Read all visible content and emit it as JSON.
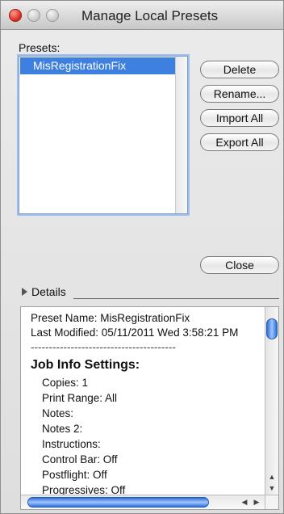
{
  "window": {
    "title": "Manage Local Presets"
  },
  "presets": {
    "label": "Presets:",
    "items": [
      "MisRegistrationFix"
    ]
  },
  "buttons": {
    "delete": "Delete",
    "rename": "Rename...",
    "import_all": "Import All",
    "export_all": "Export All",
    "close": "Close"
  },
  "details": {
    "label": "Details",
    "lines": {
      "preset_name": "Preset Name: MisRegistrationFix",
      "last_modified": "Last Modified: 05/11/2011 Wed 3:58:21 PM",
      "separator": "----------------------------------------",
      "heading": "Job Info Settings:",
      "copies": "Copies: 1",
      "print_range": "Print Range: All",
      "notes": "Notes:",
      "notes2": "Notes 2:",
      "instructions": "Instructions:",
      "control_bar": "Control Bar: Off",
      "postflight": "Postflight: Off",
      "progressives": "Progressives: Off"
    }
  },
  "colors": {
    "selection": "#3d80df",
    "close_button": "#e0382b"
  }
}
